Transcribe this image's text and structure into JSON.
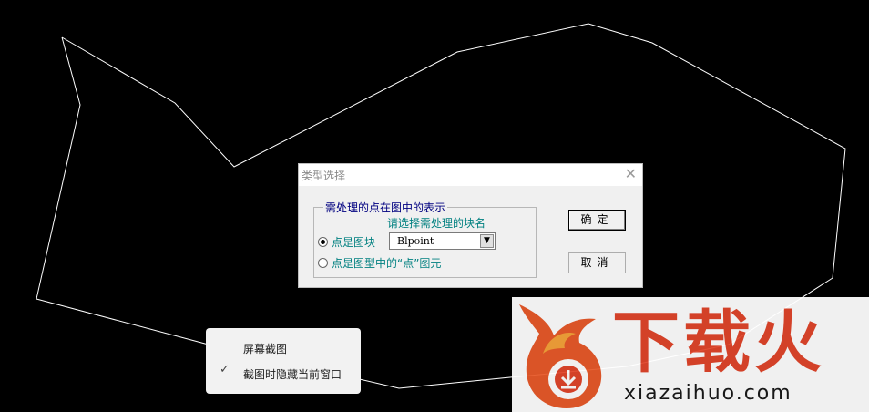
{
  "dialog": {
    "title": "类型选择",
    "close_glyph": "✕",
    "group_legend": "需处理的点在图中的表示",
    "hint": "请选择需处理的块名",
    "option_block": "点是图块",
    "option_point": "点是图型中的“点”图元",
    "selected_option": "option_block",
    "block_name": "Blpoint",
    "ok_label": "确定",
    "cancel_label": "取消"
  },
  "context_menu": {
    "items": [
      {
        "label": "屏幕截图",
        "checked": false
      },
      {
        "label": "截图时隐藏当前窗口",
        "checked": true
      }
    ],
    "check_glyph": "✓"
  },
  "watermark": {
    "brand": "下载火",
    "url": "xiazaihuo.com",
    "color": "#e1462b"
  },
  "colors": {
    "background": "#000000",
    "polyline": "#ffffff"
  }
}
